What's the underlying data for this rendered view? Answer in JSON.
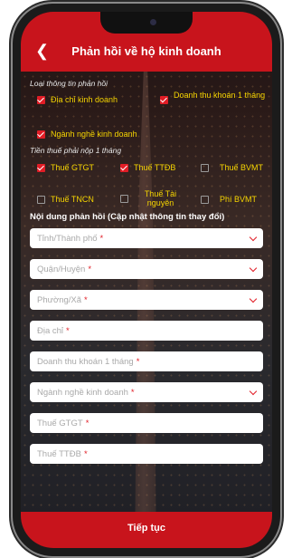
{
  "header": {
    "title": "Phản hồi về hộ kinh doanh",
    "back_icon": "chevron-left-icon"
  },
  "info_type": {
    "label": "Loại thông tin phản hồi",
    "options": [
      {
        "label": "Địa chỉ kinh doanh",
        "checked": true
      },
      {
        "label": "Doanh thu khoán 1 tháng",
        "checked": true
      },
      {
        "label": "Ngành nghề kinh doanh",
        "checked": true
      }
    ]
  },
  "taxes": {
    "label": "Tiền thuế phải nộp 1 tháng",
    "options": [
      {
        "label": "Thuế GTGT",
        "checked": true
      },
      {
        "label": "Thuế TTĐB",
        "checked": true
      },
      {
        "label": "Thuế BVMT",
        "checked": false
      },
      {
        "label": "Thuế TNCN",
        "checked": false
      },
      {
        "label": "Thuế Tài nguyên",
        "checked": false
      },
      {
        "label": "Phí BVMT",
        "checked": false
      }
    ]
  },
  "form": {
    "heading": "Nội dung phản hồi (Cập nhật thông tin thay đổi)",
    "required_mark": "*",
    "fields": [
      {
        "placeholder": "Tỉnh/Thành phố",
        "dropdown": true
      },
      {
        "placeholder": "Quận/Huyện",
        "dropdown": true
      },
      {
        "placeholder": "Phường/Xã",
        "dropdown": true
      },
      {
        "placeholder": "Địa chỉ",
        "dropdown": false
      },
      {
        "placeholder": "Doanh thu khoán 1 tháng",
        "dropdown": false
      },
      {
        "placeholder": "Ngành nghề kinh doanh",
        "dropdown": true
      },
      {
        "placeholder": "Thuế GTGT",
        "dropdown": false
      },
      {
        "placeholder": "Thuế TTĐB",
        "dropdown": false
      }
    ]
  },
  "footer": {
    "continue_label": "Tiếp tục"
  },
  "colors": {
    "brand_red": "#c8141c",
    "checkbox_red": "#e11d26",
    "option_text": "#f5d400"
  }
}
